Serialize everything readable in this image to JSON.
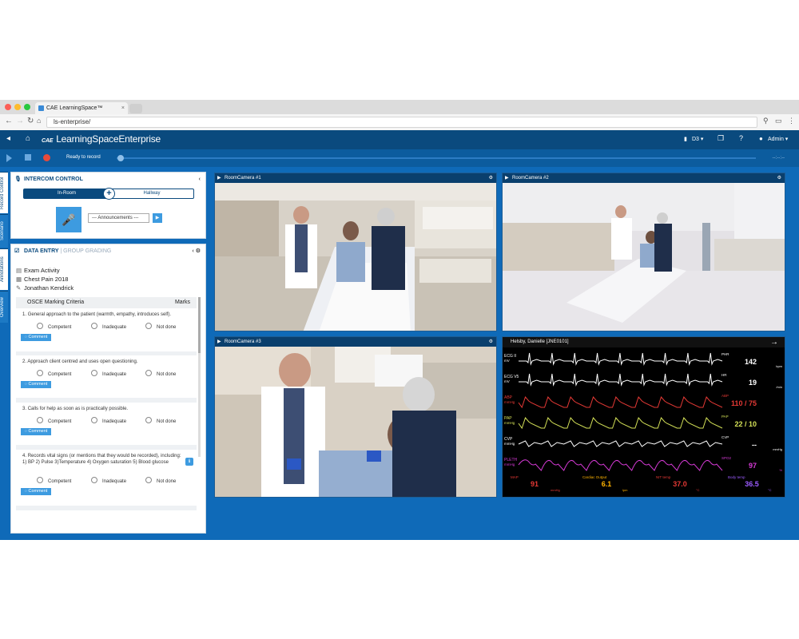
{
  "browser": {
    "tab_title": "CAE LearningSpace™",
    "tab_close": "×",
    "url": "ls-enterprise/"
  },
  "app": {
    "logo_brand": "CAE",
    "logo_text": "LearningSpaceEnterprise",
    "room_selector": "D3 ▾",
    "user_menu": "Admin ▾",
    "help": "?",
    "status": "Ready to record",
    "timecode": "--:--:--",
    "colors": {
      "header": "#0a4a7e",
      "background": "#0f6ab8",
      "accent": "#3d9be0",
      "record": "#e64a3c"
    }
  },
  "side_tabs": [
    "Record Control",
    "Scenario",
    "Annotations",
    "Overview"
  ],
  "intercom": {
    "title": "INTERCOM CONTROL",
    "in_room": "In-Room",
    "hallway": "Hallway",
    "announcements": "--- Announcements ---"
  },
  "data_entry": {
    "title": "DATA ENTRY",
    "subtitle": "GROUP GRADING",
    "activity": "Exam Activity",
    "scenario": "Chest Pain 2018",
    "learner": "Jonathan Kendrick",
    "criteria_title": "OSCE Marking Criteria",
    "marks_label": "Marks",
    "options": [
      "Competent",
      "Inadequate",
      "Not done"
    ],
    "comment_label": "Comment",
    "items": [
      {
        "num": "1.",
        "text": "General approach to the patient (warmth, empathy, introduces self)."
      },
      {
        "num": "2.",
        "text": "Approach client centred and uses open questioning."
      },
      {
        "num": "3.",
        "text": "Calls for help as soon as is practically possible."
      },
      {
        "num": "4.",
        "text": "Records vital signs (or mentions that they would be recorded), including: 1) BP 2) Pulse 3)Temperature 4) Oxygen saturation 5) Blood glucose"
      }
    ]
  },
  "cameras": [
    {
      "title": "RoomCamera #1"
    },
    {
      "title": "RoomCamera #2"
    },
    {
      "title": "RoomCamera #3"
    }
  ],
  "monitor": {
    "patient": "Helsby, Danielle [JNE0101]",
    "waves": [
      {
        "label": "ECG II",
        "sub": "mV",
        "color": "#ffffff",
        "tag": "PHR",
        "value": "142",
        "unit": "bpm"
      },
      {
        "label": "ECG V5",
        "sub": "mV",
        "color": "#ffffff",
        "tag": "HR",
        "value": "19",
        "unit": "/min"
      },
      {
        "label": "ABP",
        "sub": "mmHg",
        "color": "#e53935",
        "tag": "ABP",
        "value": "110 / 75",
        "unit": ""
      },
      {
        "label": "PAP",
        "sub": "mmHg",
        "color": "#d4e157",
        "tag": "PAP",
        "value": "22 / 10",
        "unit": ""
      },
      {
        "label": "CVP",
        "sub": "mmHg",
        "color": "#ffffff",
        "tag": "CVP",
        "value": "--",
        "unit": "mmHg"
      },
      {
        "label": "PLETH",
        "sub": "mmHg",
        "color": "#d63ad6",
        "tag": "SPO2",
        "value": "97",
        "unit": "%"
      }
    ],
    "bottom": [
      {
        "label": "MAP",
        "value": "91",
        "unit": "mmHg",
        "color": "#e53935"
      },
      {
        "label": "Cardiac Output",
        "value": "6.1",
        "unit": "lpm",
        "color": "#ffb300"
      },
      {
        "label": "NIT temp",
        "value": "37.0",
        "unit": "°C",
        "color": "#e53935"
      },
      {
        "label": "Body temp",
        "value": "36.5",
        "unit": "°C",
        "color": "#9c5cff"
      }
    ]
  }
}
